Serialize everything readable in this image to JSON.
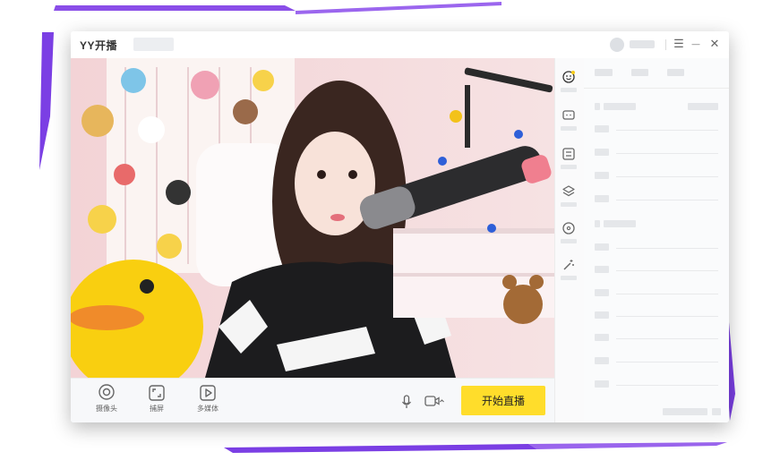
{
  "app": {
    "logo": "YY开播"
  },
  "window_controls": {
    "menu": "☰",
    "minimize": "—",
    "close": "✕"
  },
  "toolbar": {
    "camera_label": "摄像头",
    "capture_label": "捕屏",
    "media_label": "多媒体",
    "start_button": "开始直播"
  },
  "sidebar_icons": [
    "sticker-icon",
    "chat-icon",
    "list-icon",
    "layers-icon",
    "music-disc-icon",
    "magic-wand-icon"
  ],
  "colors": {
    "accent": "#ffdd2b",
    "brand_purple": "#7b3fe4"
  }
}
